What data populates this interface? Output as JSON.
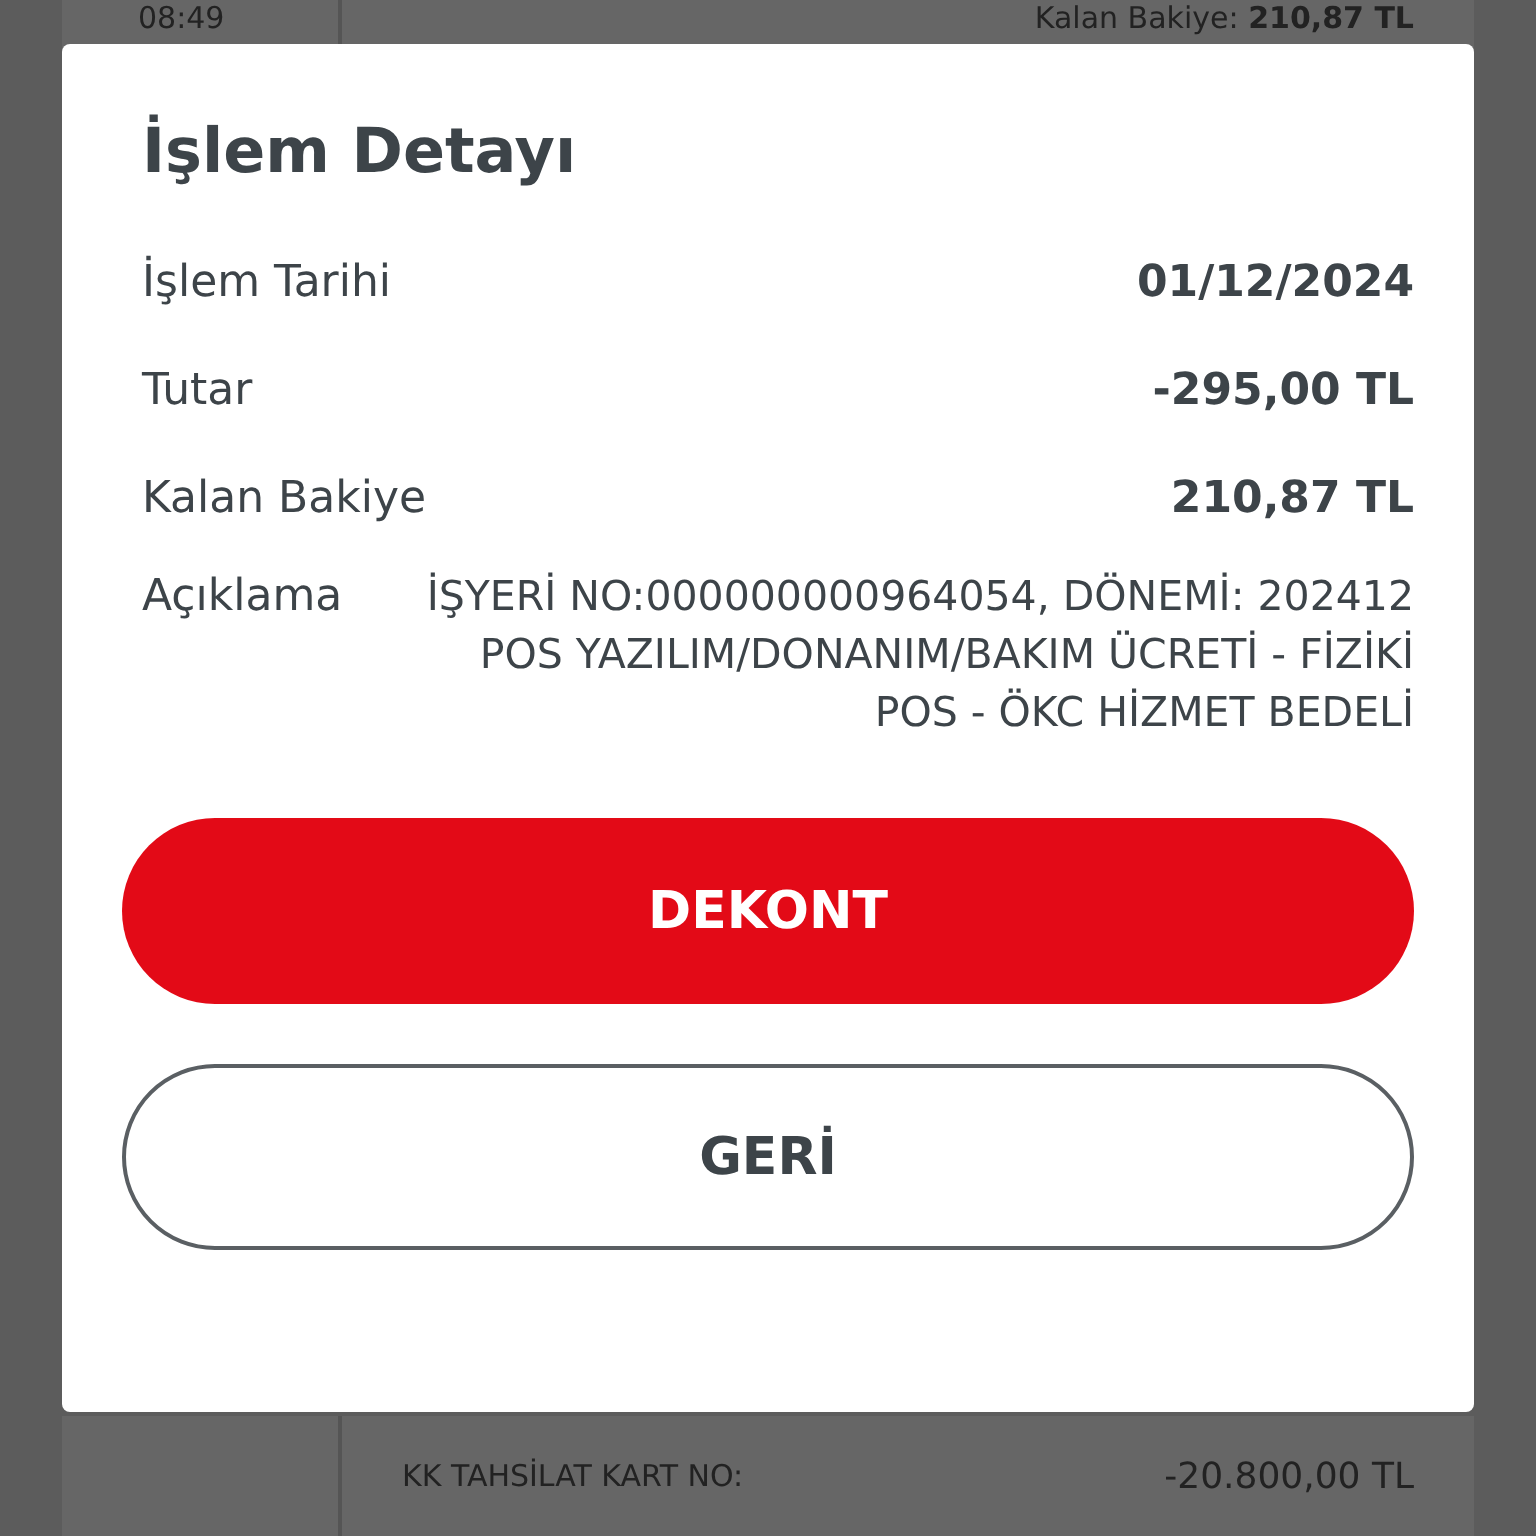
{
  "background": {
    "top_card": {
      "time": "08:49",
      "balance_label": "Kalan Bakiye:",
      "balance_value": "210,87 TL"
    },
    "bottom_card": {
      "description": "KK TAHSİLAT KART NO:",
      "amount": "-20.800,00 TL"
    }
  },
  "dialog": {
    "title": "İşlem Detayı",
    "rows": [
      {
        "label": "İşlem Tarihi",
        "value": "01/12/2024"
      },
      {
        "label": "Tutar",
        "value": "-295,00 TL"
      },
      {
        "label": "Kalan Bakiye",
        "value": "210,87 TL"
      }
    ],
    "description": {
      "label": "Açıklama",
      "value": "İŞYERİ NO:000000000964054, DÖNEMİ: 202412 POS YAZILIM/DONANIM/BAKIM ÜCRETİ - FİZİKİ POS - ÖKC HİZMET BEDELİ"
    },
    "buttons": [
      {
        "label": "DEKONT",
        "kind": "primary"
      },
      {
        "label": "GERİ",
        "kind": "secondary"
      }
    ]
  }
}
